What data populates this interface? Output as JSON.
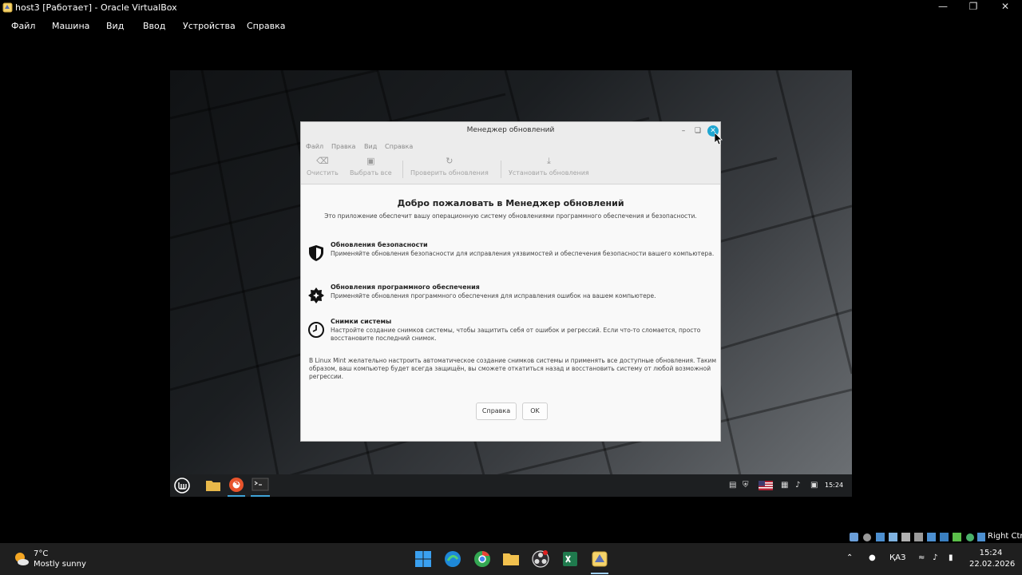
{
  "vbox": {
    "title": "host3 [Работает] - Oracle VirtualBox",
    "menu": [
      "Файл",
      "Машина",
      "Вид",
      "Ввод",
      "Устройства",
      "Справка"
    ]
  },
  "update_manager": {
    "title": "Менеджер обновлений",
    "menu": [
      "Файл",
      "Правка",
      "Вид",
      "Справка"
    ],
    "toolbar": {
      "clear": "Очистить",
      "select_all": "Выбрать все",
      "check": "Проверить обновления",
      "install": "Установить обновления"
    },
    "welcome_title": "Добро пожаловать в Менеджер обновлений",
    "intro": "Это приложение обеспечит вашу операционную систему обновлениями программного обеспечения и безопасности.",
    "features": [
      {
        "title": "Обновления безопасности",
        "desc": "Применяйте обновления безопасности для исправления уязвимостей и обеспечения безопасности вашего компьютера.",
        "icon": "shield-icon"
      },
      {
        "title": "Обновления программного обеспечения",
        "desc": "Применяйте обновления программного обеспечения для исправления ошибок на вашем компьютере.",
        "icon": "gear-star-icon"
      },
      {
        "title": "Снимки системы",
        "desc": "Настройте создание снимков системы, чтобы защитить себя от ошибок и регрессий. Если что-то сломается, просто восстановите последний снимок.",
        "icon": "clock-icon"
      }
    ],
    "note": "В Linux Mint желательно настроить автоматическое создание снимков системы и применять все доступные обновления. Таким образом, ваш компьютер будет всегда защищён, вы сможете откатиться назад и восстановить систему от любой возможной регрессии.",
    "help_button": "Справка",
    "ok_button": "OK"
  },
  "mint_panel": {
    "clock": "15:24"
  },
  "vbox_status": {
    "host_key": "Right Ctrl"
  },
  "windows_taskbar": {
    "weather_temp": "7°C",
    "weather_desc": "Mostly sunny",
    "lang": "ҚАЗ",
    "time": "15:24",
    "date": "22.02.2026"
  },
  "colors": {
    "close_accent": "#1fa6d1",
    "mint_active": "#3fa4d8"
  }
}
